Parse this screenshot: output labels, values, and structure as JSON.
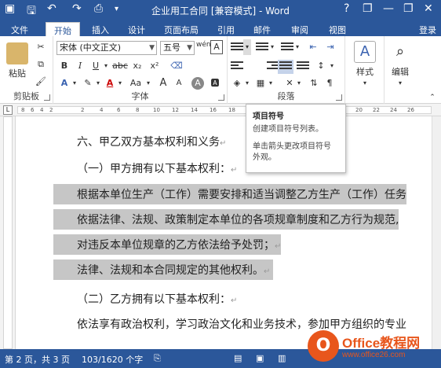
{
  "window": {
    "title": "企业用工合同 [兼容模式] - Word",
    "help": "?",
    "minimize": "—",
    "restore": "❐",
    "close": "✕"
  },
  "tabs": [
    "文件",
    "开始",
    "插入",
    "设计",
    "页面布局",
    "引用",
    "邮件",
    "审阅",
    "视图"
  ],
  "active_tab": "开始",
  "login": "登录",
  "ribbon": {
    "clipboard": {
      "label": "剪贴板",
      "paste": "粘贴"
    },
    "font": {
      "label": "字体",
      "font_name": "宋体 (中文正文)",
      "font_size": "五号",
      "bold": "B",
      "italic": "I",
      "underline": "U",
      "strike": "abc",
      "subscript": "x₂",
      "superscript": "x²",
      "case": "Aa",
      "grow": "A",
      "shrink": "A",
      "wen": "wén",
      "char_border": "A"
    },
    "paragraph": {
      "label": "段落"
    },
    "styles": {
      "label": "样式"
    },
    "editing": {
      "label": "编辑"
    }
  },
  "tooltip": {
    "title": "项目符号",
    "desc": "创建项目符号列表。",
    "line1": "单击箭头更改项目符号",
    "line2": "外观。"
  },
  "ruler_ticks": [
    "8",
    "6",
    "4",
    "2",
    "2",
    "4",
    "6",
    "8",
    "10",
    "12",
    "14",
    "16",
    "18",
    "20",
    "22",
    "24",
    "26"
  ],
  "document": {
    "lines": [
      {
        "text": "六、甲乙双方基本权利和义务",
        "selected": false
      },
      {
        "text": "（一）甲方拥有以下基本权利：",
        "selected": false
      },
      {
        "text": "根据本单位生产（工作）需要安排和适当调整乙方生产（工作）任务",
        "selected": true
      },
      {
        "text": "依据法律、法规、政策制定本单位的各项规章制度和乙方行为规范,",
        "selected": true
      },
      {
        "text": "对违反本单位规章的乙方依法给予处罚；",
        "selected": true
      },
      {
        "text": "法律、法规和本合同规定的其他权利。",
        "selected": true
      },
      {
        "text": "（二）乙方拥有以下基本权利：",
        "selected": false
      },
      {
        "text": "依法享有政治权利，学习政治文化和业务技术，参加甲方组织的专业",
        "selected": false
      }
    ]
  },
  "status": {
    "page": "第 2 页，共 3 页",
    "words": "103/1620 个字"
  },
  "watermark": {
    "logo": "O",
    "brand": "Office教程网",
    "site": "www.office26.com"
  },
  "colors": {
    "accent": "#2b579a",
    "selection": "#c6c6c6",
    "watermark": "#e8561c"
  }
}
